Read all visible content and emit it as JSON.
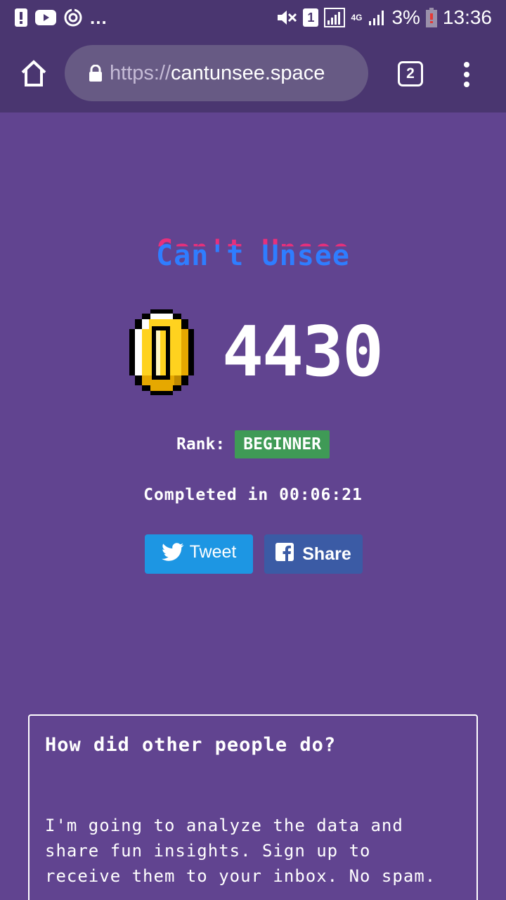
{
  "status_bar": {
    "overflow": "...",
    "sim_slot": "1",
    "network": "4G",
    "battery": "3%",
    "time": "13:36",
    "icons": [
      "alert-icon",
      "youtube-icon",
      "data-saver-icon",
      "mute-icon",
      "sim-icon",
      "signal-icon",
      "network-type-icon",
      "signal-icon",
      "battery-icon"
    ]
  },
  "browser": {
    "url_scheme": "https://",
    "url_host": "cantunsee.space",
    "tab_count": "2",
    "icons": [
      "home-icon",
      "lock-icon",
      "tabs-icon",
      "more-vert-icon"
    ]
  },
  "game": {
    "logo": "Can't Unsee",
    "score": "4430",
    "rank_label": "Rank:",
    "rank_value": "BEGINNER",
    "completed": "Completed in 00:06:21",
    "colors": {
      "background": "#614490",
      "rank_badge": "#3f9a56",
      "tweet": "#1d96e3",
      "share": "#3b5ba5"
    }
  },
  "buttons": {
    "tweet": "Tweet",
    "share": "Share"
  },
  "card": {
    "title": "How did other people do?",
    "body": "I'm going to analyze the data and\nshare fun insights. Sign up to\nreceive them to your inbox. No spam."
  }
}
